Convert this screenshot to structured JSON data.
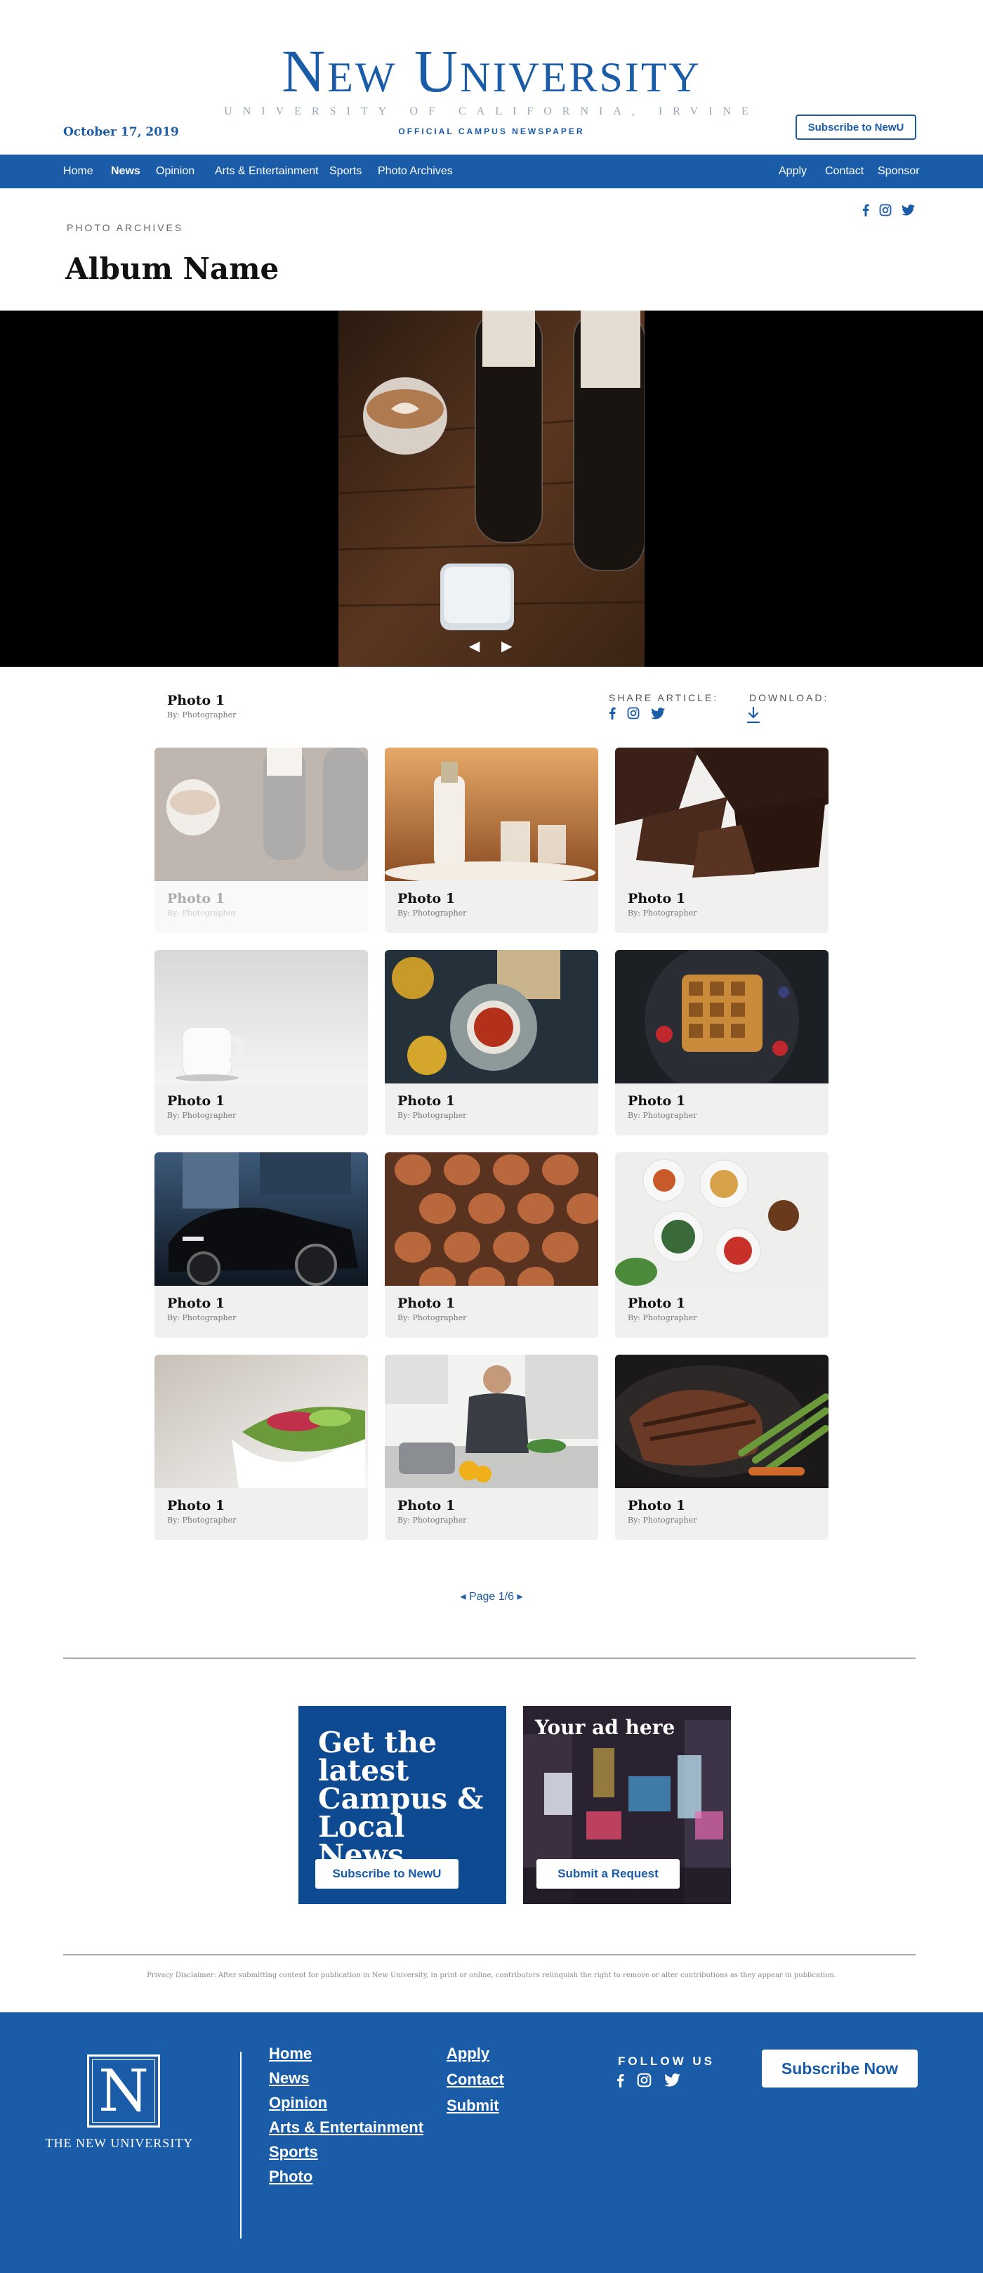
{
  "masthead": {
    "title": "New University",
    "subtitle": "UNIVERSITY OF CALIFORNIA, IRVINE",
    "tagline": "OFFICIAL CAMPUS NEWSPAPER",
    "date": "October 17, 2019",
    "subscribe_label": "Subscribe to NewU"
  },
  "nav": {
    "left": [
      "Home",
      "News",
      "Opinion",
      "Arts & Entertainment",
      "Sports",
      "Photo Archives"
    ],
    "active": "News",
    "right": [
      "Apply",
      "Contact",
      "Sponsor"
    ]
  },
  "page": {
    "eyebrow": "PHOTO ARCHIVES",
    "title": "Album Name"
  },
  "viewer": {
    "prev_icon": "triangle-left-icon",
    "next_icon": "triangle-right-icon"
  },
  "current_photo": {
    "title": "Photo 1",
    "byline": "By: Photographer",
    "share_label": "SHARE ARTICLE:",
    "download_label": "DOWNLOAD:"
  },
  "gallery": [
    {
      "title": "Photo 1",
      "byline": "By: Photographer",
      "subject": "coffee"
    },
    {
      "title": "Photo 1",
      "byline": "By: Photographer",
      "subject": "milk"
    },
    {
      "title": "Photo 1",
      "byline": "By: Photographer",
      "subject": "chocolate"
    },
    {
      "title": "Photo 1",
      "byline": "By: Photographer",
      "subject": "mug"
    },
    {
      "title": "Photo 1",
      "byline": "By: Photographer",
      "subject": "tea"
    },
    {
      "title": "Photo 1",
      "byline": "By: Photographer",
      "subject": "waffle"
    },
    {
      "title": "Photo 1",
      "byline": "By: Photographer",
      "subject": "car"
    },
    {
      "title": "Photo 1",
      "byline": "By: Photographer",
      "subject": "eggs"
    },
    {
      "title": "Photo 1",
      "byline": "By: Photographer",
      "subject": "brunch"
    },
    {
      "title": "Photo 1",
      "byline": "By: Photographer",
      "subject": "salad"
    },
    {
      "title": "Photo 1",
      "byline": "By: Photographer",
      "subject": "kitchen"
    },
    {
      "title": "Photo 1",
      "byline": "By: Photographer",
      "subject": "steak"
    }
  ],
  "pager": {
    "label": "◂ Page 1/6 ▸"
  },
  "ads": {
    "campus_text": "Get the latest Campus & Local News",
    "campus_button": "Subscribe to NewU",
    "your_ad": "Your ad here",
    "request_button": "Submit a Request"
  },
  "disclaimer": "Privacy Disclaimer: After submitting content for publication in New University, in print or online, contributors relinquish the right to remove or alter contributions as they appear in publication.",
  "footer": {
    "logo_letter": "N",
    "logo_name": "THE NEW UNIVERSITY",
    "links_col1": [
      "Home",
      "News",
      "Opinion",
      "Arts & Entertainment",
      "Sports",
      "Photo"
    ],
    "links_col2": [
      "Apply",
      "Contact",
      "Submit"
    ],
    "follow_label": "FOLLOW US",
    "subscribe_label": "Subscribe Now"
  },
  "colors": {
    "brand_blue": "#1a5ca8",
    "ad_blue": "#0e4a92",
    "card_bg": "#f0f0f0"
  }
}
